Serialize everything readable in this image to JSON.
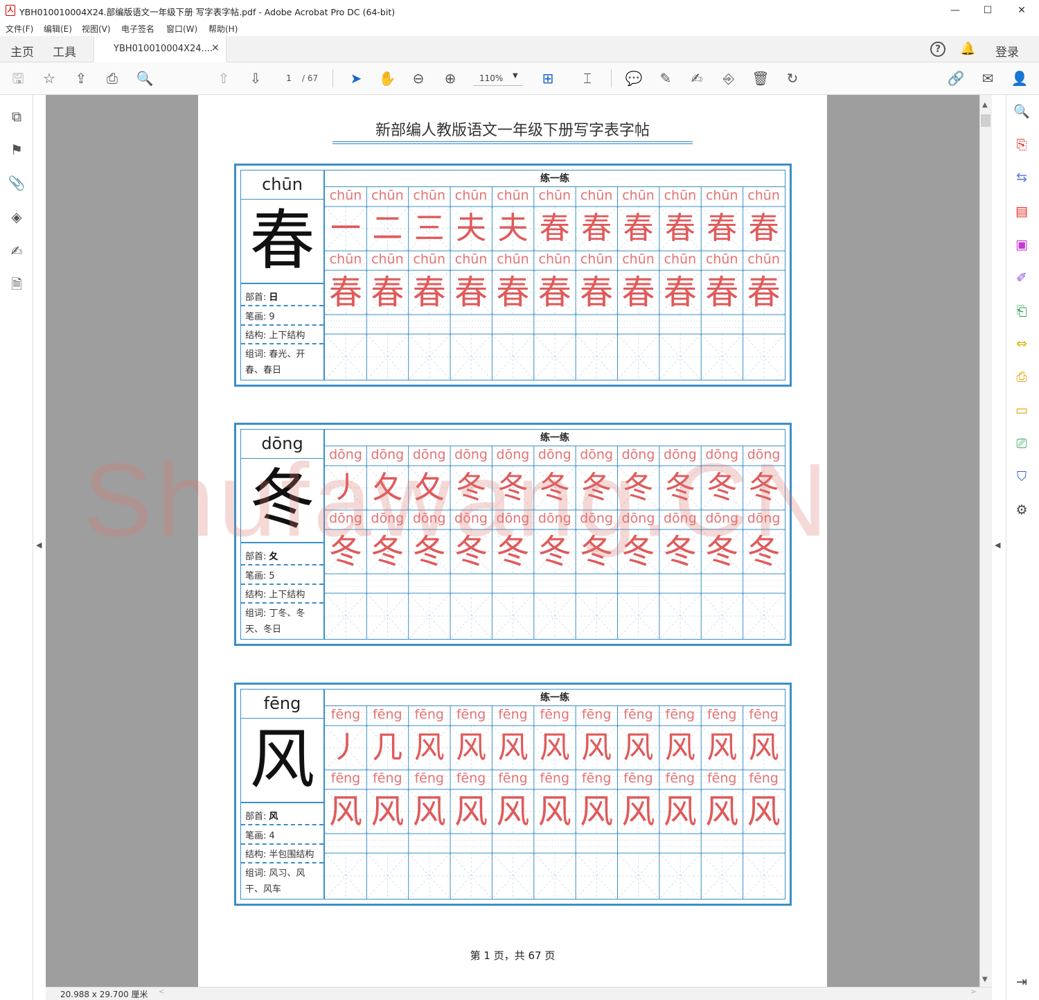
{
  "window": {
    "title": "YBH010010004X24.部编版语文一年级下册 写字表字帖.pdf - Adobe Acrobat Pro DC (64-bit)",
    "app_icon_glyph": "人",
    "minimize_glyph": "—",
    "maximize_glyph": "☐",
    "close_glyph": "✕"
  },
  "menu": [
    "文件(F)",
    "编辑(E)",
    "视图(V)",
    "电子签名",
    "窗口(W)",
    "帮助(H)"
  ],
  "tabs": {
    "home": "主页",
    "tools": "工具",
    "document": "YBH010010004X24....",
    "close_glyph": "×",
    "help_glyph": "?",
    "bell_glyph": "🔔",
    "login": "登录"
  },
  "toolbar": {
    "page_current": "1",
    "page_total": "/ 67",
    "zoom": "110%",
    "zoom_caret": "▼",
    "icons": {
      "save": "🖫",
      "bookmark_star": "☆",
      "upload": "⇪",
      "print": "⎙",
      "find": "🔍",
      "prev_page": "⇧",
      "next_page": "⇩",
      "select": "➤",
      "hand": "✋",
      "zoom_out": "⊖",
      "zoom_in": "⊕",
      "fit": "⊞",
      "read": "⌶",
      "comment": "💬",
      "highlight": "✎",
      "sign": "✍",
      "stamp": "⎆",
      "delete": "🗑",
      "rotate": "↻",
      "share_link": "🔗",
      "email": "✉",
      "account": "👤"
    }
  },
  "left_rail": {
    "icons": [
      "⧉",
      "⚑",
      "📎",
      "◈",
      "✍",
      "🗎"
    ]
  },
  "right_rail": {
    "icons": [
      {
        "glyph": "🔍",
        "color": "#444"
      },
      {
        "glyph": "⎘",
        "color": "#e5322d"
      },
      {
        "glyph": "⇆",
        "color": "#5a7de0"
      },
      {
        "glyph": "▤",
        "color": "#e5322d"
      },
      {
        "glyph": "▣",
        "color": "#c43bd1"
      },
      {
        "glyph": "✐",
        "color": "#8a4cd6"
      },
      {
        "glyph": "⎗",
        "color": "#2e9c52"
      },
      {
        "glyph": "⇔",
        "color": "#d6b400"
      },
      {
        "glyph": "⎙",
        "color": "#e5a000"
      },
      {
        "glyph": "▭",
        "color": "#e5a000"
      },
      {
        "glyph": "⎚",
        "color": "#2e9c52"
      },
      {
        "glyph": "⛉",
        "color": "#3b5bd1"
      },
      {
        "glyph": "⚙",
        "color": "#444"
      }
    ]
  },
  "scroll": {
    "up": "▲",
    "down": "▼",
    "left": "<",
    "right": ">",
    "collapse_left": "◀",
    "collapse_right": "◀",
    "collapse_rail": "⇥"
  },
  "status": {
    "page_size": "20.988 x 29.700 厘米"
  },
  "document": {
    "title": "新部编人教版语文一年级下册写字表字帖",
    "practice_heading": "练一练",
    "footer": "第 1 页，共 67 页",
    "watermark": "Shufawang.CN",
    "labels": {
      "radical": "部首:",
      "strokes": "笔画:",
      "structure": "结构:",
      "words": "组词:"
    },
    "characters": [
      {
        "pinyin": "chūn",
        "char": "春",
        "radical": "日",
        "strokes": "9",
        "structure": "上下结构",
        "words": "春光、开春、春日",
        "stroke_steps": [
          "一",
          "二",
          "三",
          "夫",
          "夫",
          "春",
          "春",
          "春",
          "春",
          "春",
          "春"
        ]
      },
      {
        "pinyin": "dōng",
        "char": "冬",
        "radical": "夂",
        "strokes": "5",
        "structure": "上下结构",
        "words": "丁冬、冬天、冬日",
        "stroke_steps": [
          "丿",
          "夂",
          "夂",
          "冬",
          "冬",
          "冬",
          "冬",
          "冬",
          "冬",
          "冬",
          "冬"
        ]
      },
      {
        "pinyin": "fēng",
        "char": "风",
        "radical": "风",
        "strokes": "4",
        "structure": "半包围结构",
        "words": "风习、风干、风车",
        "stroke_steps": [
          "丿",
          "几",
          "风",
          "风",
          "风",
          "风",
          "风",
          "风",
          "风",
          "风",
          "风"
        ]
      }
    ]
  }
}
